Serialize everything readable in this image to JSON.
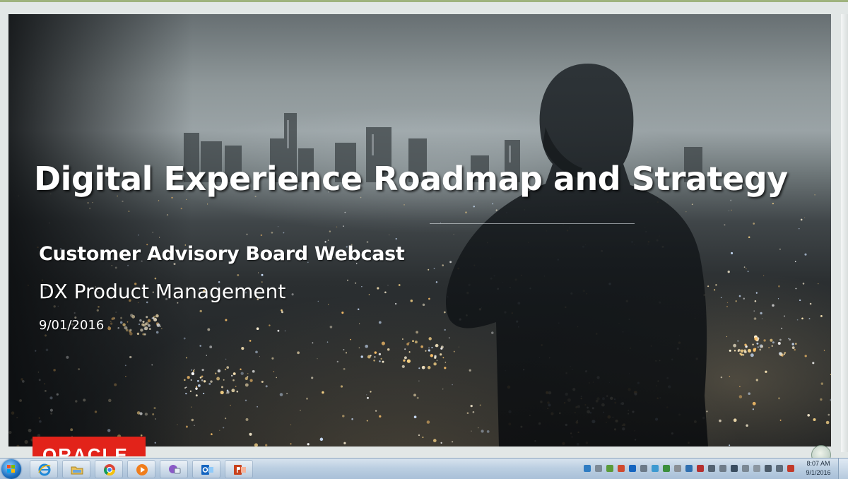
{
  "slide": {
    "title": "Digital Experience Roadmap and Strategy",
    "subtitle": "Customer Advisory Board Webcast",
    "team": "DX Product Management",
    "date": "9/01/2016",
    "logo_text": "ORACLE"
  },
  "taskbar": {
    "apps": [
      {
        "name": "Internet Explorer",
        "icon": "internet-explorer-icon"
      },
      {
        "name": "Windows Explorer",
        "icon": "folder-icon"
      },
      {
        "name": "Google Chrome",
        "icon": "chrome-icon"
      },
      {
        "name": "Windows Media Player",
        "icon": "media-player-icon"
      },
      {
        "name": "Chat",
        "icon": "chat-icon"
      },
      {
        "name": "Outlook",
        "icon": "outlook-icon"
      },
      {
        "name": "PowerPoint",
        "icon": "powerpoint-icon"
      }
    ],
    "clock_time": "8:07 AM",
    "clock_date": "9/1/2016"
  },
  "colors": {
    "oracle_red": "#e2231a",
    "taskbar_top": "#d8e4ef",
    "taskbar_bottom": "#a9c0d8",
    "slide_text": "#ffffff"
  }
}
